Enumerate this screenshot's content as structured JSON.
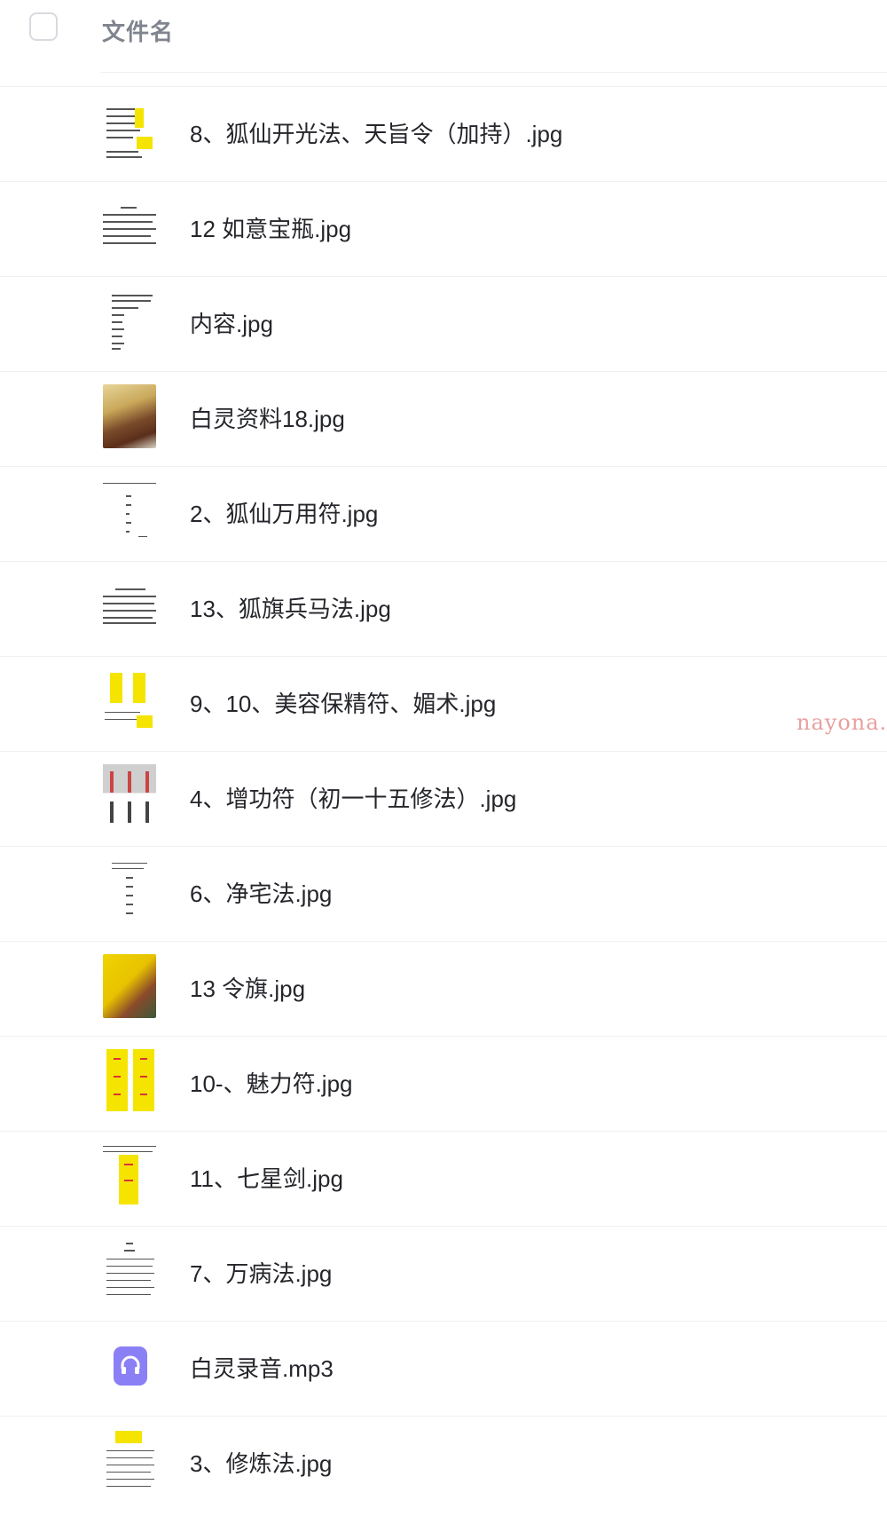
{
  "header": {
    "title": "文件名"
  },
  "files": [
    {
      "name": "8、狐仙开光法、天旨令（加持）.jpg",
      "thumb": "doc-yellow-right-icon"
    },
    {
      "name": "12 如意宝瓶.jpg",
      "thumb": "doc-text-icon"
    },
    {
      "name": "内容.jpg",
      "thumb": "doc-list-icon"
    },
    {
      "name": "白灵资料18.jpg",
      "thumb": "photo-food-icon"
    },
    {
      "name": "2、狐仙万用符.jpg",
      "thumb": "doc-sparse-icon"
    },
    {
      "name": "13、狐旗兵马法.jpg",
      "thumb": "doc-text-icon"
    },
    {
      "name": "9、10、美容保精符、媚术.jpg",
      "thumb": "talisman-yellow-pair-icon"
    },
    {
      "name": "4、增功符（初一十五修法）.jpg",
      "thumb": "talisman-red-grid-icon"
    },
    {
      "name": "6、净宅法.jpg",
      "thumb": "doc-sparse-icon"
    },
    {
      "name": "13 令旗.jpg",
      "thumb": "photo-flag-icon"
    },
    {
      "name": "10-、魅力符.jpg",
      "thumb": "talisman-yellow-pair-icon"
    },
    {
      "name": "11、七星剑.jpg",
      "thumb": "talisman-yellow-single-icon"
    },
    {
      "name": "7、万病法.jpg",
      "thumb": "doc-text-icon"
    },
    {
      "name": "白灵录音.mp3",
      "thumb": "audio-headphones-icon"
    },
    {
      "name": "3、修炼法.jpg",
      "thumb": "doc-yellow-top-icon"
    }
  ],
  "watermark": "nayona.",
  "colors": {
    "accent_audio": "#8b7ff6",
    "talisman_yellow": "#f5e400",
    "divider": "#eef0f3"
  }
}
